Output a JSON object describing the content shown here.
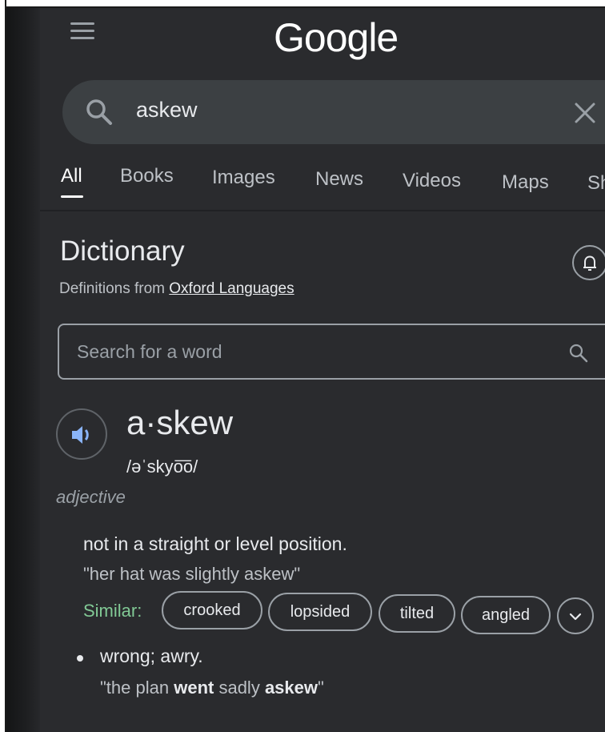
{
  "header": {
    "logo_text": "Google"
  },
  "search": {
    "query": "askew"
  },
  "tabs": [
    {
      "label": "All",
      "active": true
    },
    {
      "label": "Books"
    },
    {
      "label": "Images"
    },
    {
      "label": "News"
    },
    {
      "label": "Videos"
    },
    {
      "label": "Maps"
    },
    {
      "label": "Sh"
    }
  ],
  "dictionary": {
    "title": "Dictionary",
    "source_prefix": "Definitions from ",
    "source_link": "Oxford Languages",
    "word_search_placeholder": "Search for a word",
    "headword": "a·skew",
    "phonetic": "/əˈskyo͞o/",
    "part_of_speech": "adjective",
    "sense1": {
      "definition": "not in a straight or level position.",
      "example": "\"her hat was slightly askew\"",
      "similar_label": "Similar:",
      "similar": [
        "crooked",
        "lopsided",
        "tilted",
        "angled"
      ]
    },
    "sense2": {
      "definition": "wrong; awry.",
      "example_parts": [
        "\"the plan ",
        "went",
        " sadly ",
        "askew",
        "\""
      ]
    }
  },
  "colors": {
    "background": "#2a2b2e",
    "search_bg": "#3c4043",
    "similar_green": "#81c995",
    "text_primary": "#e8eaed",
    "text_secondary": "#bdc1c6"
  },
  "icons": {
    "menu": "menu-icon",
    "search": "search-icon",
    "clear": "close-icon",
    "alert": "bell-plus-icon",
    "speaker": "speaker-icon",
    "expand": "chevron-down-icon"
  }
}
